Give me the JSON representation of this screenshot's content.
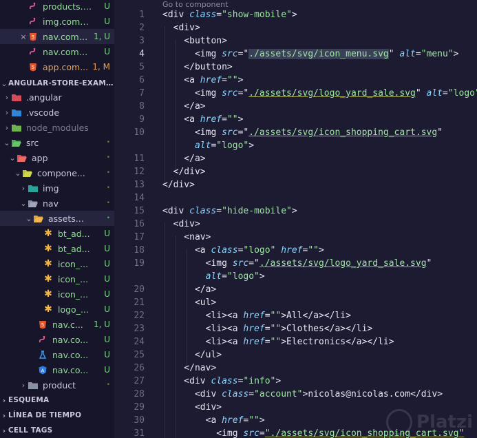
{
  "explorer": {
    "items": [
      {
        "label": "products.c...",
        "badge": "U",
        "icon": "angular-file-icon",
        "indent": 40,
        "chevron": ""
      },
      {
        "label": "img.compo...",
        "badge": "U",
        "icon": "angular-file-icon",
        "indent": 40,
        "chevron": ""
      },
      {
        "label": "nav.comp...",
        "badge": "1, U",
        "icon": "html-file-icon",
        "indent": 40,
        "chevron": "×",
        "selected": true
      },
      {
        "label": "nav.compo...",
        "badge": "U",
        "icon": "angular-file-icon",
        "indent": 40,
        "chevron": ""
      },
      {
        "label": "app.com...",
        "badge": "1, M",
        "icon": "html-file-icon",
        "indent": 40,
        "chevron": ""
      }
    ],
    "project_title": "ANGULAR-STORE-EXAMPLE",
    "tree": [
      {
        "label": ".angular",
        "badge": "",
        "icon": "folder-angular-icon",
        "indent": 16,
        "chevron": "›"
      },
      {
        "label": ".vscode",
        "badge": "",
        "icon": "folder-vscode-icon",
        "indent": 16,
        "chevron": "›"
      },
      {
        "label": "node_modules",
        "badge": "",
        "icon": "folder-node-icon",
        "indent": 16,
        "chevron": "›",
        "dim": true
      },
      {
        "label": "src",
        "badge": "•",
        "icon": "folder-src-icon",
        "indent": 16,
        "chevron": "⌄"
      },
      {
        "label": "app",
        "badge": "•",
        "icon": "folder-app-icon",
        "indent": 24,
        "chevron": "⌄"
      },
      {
        "label": "compone...",
        "badge": "•",
        "icon": "folder-components-icon",
        "indent": 32,
        "chevron": "⌄"
      },
      {
        "label": "img",
        "badge": "•",
        "icon": "folder-img-icon",
        "indent": 40,
        "chevron": "›"
      },
      {
        "label": "nav",
        "badge": "•",
        "icon": "folder-open-icon",
        "indent": 40,
        "chevron": "⌄"
      },
      {
        "label": "assets...",
        "badge": "•",
        "icon": "folder-assets-icon",
        "indent": 48,
        "chevron": "⌄",
        "selected": true,
        "green_dot": true
      },
      {
        "label": "bt_ad...",
        "badge": "U",
        "icon": "svg-file-icon",
        "indent": 62,
        "chevron": ""
      },
      {
        "label": "bt_ad...",
        "badge": "U",
        "icon": "svg-file-icon",
        "indent": 62,
        "chevron": ""
      },
      {
        "label": "icon_...",
        "badge": "U",
        "icon": "svg-file-icon",
        "indent": 62,
        "chevron": ""
      },
      {
        "label": "icon_...",
        "badge": "U",
        "icon": "svg-file-icon",
        "indent": 62,
        "chevron": ""
      },
      {
        "label": "icon_...",
        "badge": "U",
        "icon": "svg-file-icon",
        "indent": 62,
        "chevron": ""
      },
      {
        "label": "logo_...",
        "badge": "U",
        "icon": "svg-file-icon",
        "indent": 62,
        "chevron": ""
      },
      {
        "label": "nav.c...",
        "badge": "1, U",
        "icon": "html-file-icon",
        "indent": 54,
        "chevron": ""
      },
      {
        "label": "nav.co...",
        "badge": "U",
        "icon": "angular-file-icon",
        "indent": 54,
        "chevron": ""
      },
      {
        "label": "nav.co...",
        "badge": "U",
        "icon": "test-file-icon",
        "indent": 54,
        "chevron": ""
      },
      {
        "label": "nav.co...",
        "badge": "U",
        "icon": "angular-component-icon",
        "indent": 54,
        "chevron": ""
      },
      {
        "label": "product",
        "badge": "•",
        "icon": "folder-icon",
        "indent": 40,
        "chevron": "›"
      }
    ],
    "sections": [
      "ESQUEMA",
      "LÍNEA DE TIEMPO",
      "CELL TAGS"
    ]
  },
  "editor": {
    "codelens": "Go to component",
    "current_line": "4",
    "lines": [
      {
        "n": "1",
        "t": [
          [
            "tag",
            "<div "
          ],
          [
            "attr",
            "class"
          ],
          [
            "tag",
            "="
          ],
          [
            "str",
            "\"show-mobile\""
          ],
          [
            "tag",
            ">"
          ]
        ]
      },
      {
        "n": "2",
        "t": [
          [
            "tag",
            "  <div>"
          ]
        ]
      },
      {
        "n": "3",
        "t": [
          [
            "tag",
            "    <button>"
          ]
        ]
      },
      {
        "n": "4",
        "t": [
          [
            "tag",
            "      <img "
          ],
          [
            "attr",
            "src"
          ],
          [
            "tag",
            "=\""
          ],
          [
            "hl",
            "./assets/svg/icon_menu.svg"
          ],
          [
            "tag",
            "\" "
          ],
          [
            "attr",
            "alt"
          ],
          [
            "tag",
            "="
          ],
          [
            "str",
            "\"menu\""
          ],
          [
            "tag",
            ">"
          ]
        ]
      },
      {
        "n": "5",
        "t": [
          [
            "tag",
            "    </button>"
          ]
        ]
      },
      {
        "n": "6",
        "t": [
          [
            "tag",
            "    <a "
          ],
          [
            "attr",
            "href"
          ],
          [
            "tag",
            "="
          ],
          [
            "str",
            "\"\""
          ],
          [
            "tag",
            ">"
          ]
        ]
      },
      {
        "n": "7",
        "t": [
          [
            "tag",
            "      <img "
          ],
          [
            "attr",
            "src"
          ],
          [
            "tag",
            "=\""
          ],
          [
            "str",
            "./assets/svg/logo_yard_sale.svg"
          ],
          [
            "tag",
            "\" "
          ],
          [
            "attr",
            "alt"
          ],
          [
            "tag",
            "="
          ],
          [
            "str",
            "\"logo\""
          ],
          [
            "tag",
            ">"
          ]
        ]
      },
      {
        "n": "8",
        "t": [
          [
            "tag",
            "    </a>"
          ]
        ]
      },
      {
        "n": "9",
        "t": [
          [
            "tag",
            "    <a "
          ],
          [
            "attr",
            "href"
          ],
          [
            "tag",
            "="
          ],
          [
            "str",
            "\"\""
          ],
          [
            "tag",
            ">"
          ]
        ]
      },
      {
        "n": "10",
        "t": [
          [
            "tag",
            "      <img "
          ],
          [
            "attr",
            "src"
          ],
          [
            "tag",
            "=\""
          ],
          [
            "str",
            "./assets/svg/icon_shopping_cart.svg"
          ],
          [
            "tag",
            "\""
          ]
        ]
      },
      {
        "n": "",
        "t": [
          [
            "attr",
            "      alt"
          ],
          [
            "tag",
            "="
          ],
          [
            "str",
            "\"logo\""
          ],
          [
            "tag",
            ">"
          ]
        ]
      },
      {
        "n": "11",
        "t": [
          [
            "tag",
            "    </a>"
          ]
        ]
      },
      {
        "n": "12",
        "t": [
          [
            "tag",
            "  </div>"
          ]
        ]
      },
      {
        "n": "13",
        "t": [
          [
            "tag",
            "</div>"
          ]
        ]
      },
      {
        "n": "14",
        "t": [
          [
            "tag",
            ""
          ]
        ]
      },
      {
        "n": "15",
        "t": [
          [
            "tag",
            "<div "
          ],
          [
            "attr",
            "class"
          ],
          [
            "tag",
            "="
          ],
          [
            "str",
            "\"hide-mobile\""
          ],
          [
            "tag",
            ">"
          ]
        ]
      },
      {
        "n": "16",
        "t": [
          [
            "tag",
            "  <div>"
          ]
        ]
      },
      {
        "n": "17",
        "t": [
          [
            "tag",
            "    <nav>"
          ]
        ]
      },
      {
        "n": "18",
        "t": [
          [
            "tag",
            "      <a "
          ],
          [
            "attr",
            "class"
          ],
          [
            "tag",
            "="
          ],
          [
            "str",
            "\"logo\""
          ],
          [
            "tag",
            " "
          ],
          [
            "attr",
            "href"
          ],
          [
            "tag",
            "="
          ],
          [
            "str",
            "\"\""
          ],
          [
            "tag",
            ">"
          ]
        ]
      },
      {
        "n": "19",
        "t": [
          [
            "tag",
            "        <img "
          ],
          [
            "attr",
            "src"
          ],
          [
            "tag",
            "=\""
          ],
          [
            "str",
            "./assets/svg/logo_yard_sale.svg"
          ],
          [
            "tag",
            "\""
          ]
        ]
      },
      {
        "n": "",
        "t": [
          [
            "attr",
            "        alt"
          ],
          [
            "tag",
            "="
          ],
          [
            "str",
            "\"logo\""
          ],
          [
            "tag",
            ">"
          ]
        ]
      },
      {
        "n": "20",
        "t": [
          [
            "tag",
            "      </a>"
          ]
        ]
      },
      {
        "n": "21",
        "t": [
          [
            "tag",
            "      <ul>"
          ]
        ]
      },
      {
        "n": "22",
        "t": [
          [
            "tag",
            "        <li><a "
          ],
          [
            "attr",
            "href"
          ],
          [
            "tag",
            "="
          ],
          [
            "str",
            "\"\""
          ],
          [
            "tag",
            ">"
          ],
          [
            "txt",
            "All"
          ],
          [
            "tag",
            "</a></li>"
          ]
        ]
      },
      {
        "n": "23",
        "t": [
          [
            "tag",
            "        <li><a "
          ],
          [
            "attr",
            "href"
          ],
          [
            "tag",
            "="
          ],
          [
            "str",
            "\"\""
          ],
          [
            "tag",
            ">"
          ],
          [
            "txt",
            "Clothes"
          ],
          [
            "tag",
            "</a></li>"
          ]
        ]
      },
      {
        "n": "24",
        "t": [
          [
            "tag",
            "        <li><a "
          ],
          [
            "attr",
            "href"
          ],
          [
            "tag",
            "="
          ],
          [
            "str",
            "\"\""
          ],
          [
            "tag",
            ">"
          ],
          [
            "txt",
            "Electronics"
          ],
          [
            "tag",
            "</a></li>"
          ]
        ]
      },
      {
        "n": "25",
        "t": [
          [
            "tag",
            "      </ul>"
          ]
        ]
      },
      {
        "n": "26",
        "t": [
          [
            "tag",
            "    </nav>"
          ]
        ]
      },
      {
        "n": "27",
        "t": [
          [
            "tag",
            "    <div "
          ],
          [
            "attr",
            "class"
          ],
          [
            "tag",
            "="
          ],
          [
            "str",
            "\"info\""
          ],
          [
            "tag",
            ">"
          ]
        ]
      },
      {
        "n": "28",
        "t": [
          [
            "tag",
            "      <div "
          ],
          [
            "attr",
            "class"
          ],
          [
            "tag",
            "="
          ],
          [
            "str",
            "\"account\""
          ],
          [
            "tag",
            ">"
          ],
          [
            "txt",
            "nicolas@nicolas.com"
          ],
          [
            "tag",
            "</div>"
          ]
        ]
      },
      {
        "n": "29",
        "t": [
          [
            "tag",
            "      <div>"
          ]
        ]
      },
      {
        "n": "30",
        "t": [
          [
            "tag",
            "        <a "
          ],
          [
            "attr",
            "href"
          ],
          [
            "tag",
            "="
          ],
          [
            "str",
            "\"\""
          ],
          [
            "tag",
            ">"
          ]
        ]
      },
      {
        "n": "31",
        "t": [
          [
            "tag",
            "          <img "
          ],
          [
            "attr",
            "src"
          ],
          [
            "tag",
            "="
          ],
          [
            "str",
            "\"./assets/svg/icon_shopping_cart.svg\""
          ]
        ]
      }
    ]
  },
  "watermark": "Platzi",
  "colors": {
    "bg": "#1c1b31",
    "sidebar": "#16152a",
    "string": "#9ee6a1",
    "attr": "#8bd5ff",
    "badge_u": "#7fd08a",
    "badge_m": "#e2a25a"
  }
}
